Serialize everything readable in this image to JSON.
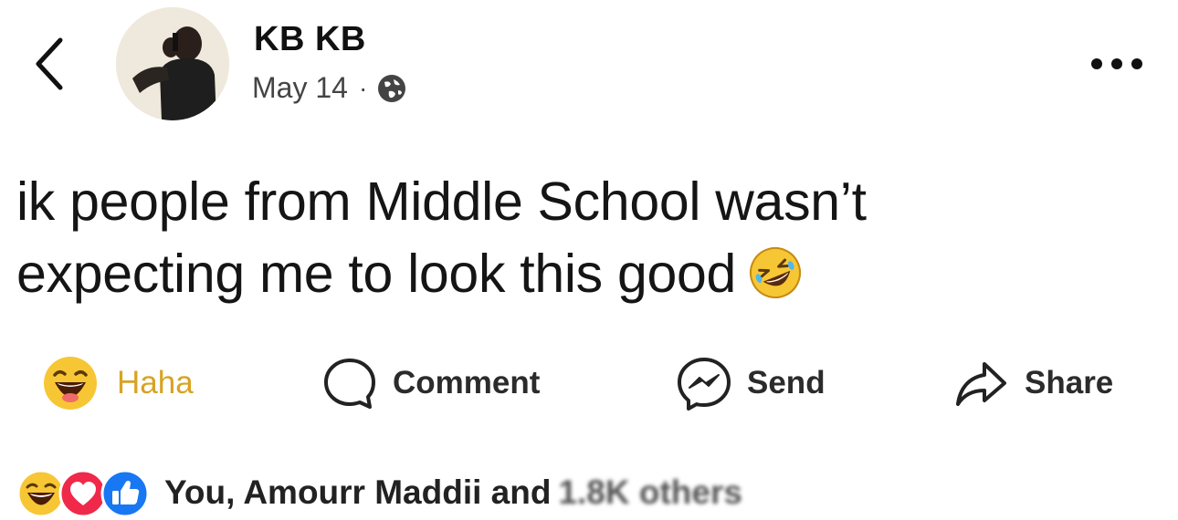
{
  "post": {
    "author": "KB KB",
    "date": "May 14",
    "separator": "·",
    "privacy_icon": "globe-icon",
    "text": "ik people from Middle School wasn’t expecting me to look this good",
    "text_emoji": "rolling-on-floor-laughing-emoji"
  },
  "actions": {
    "haha_label": "Haha",
    "comment_label": "Comment",
    "send_label": "Send",
    "share_label": "Share"
  },
  "reactions": {
    "summary": "You, Amourr Maddii and",
    "obscured": "1.8K others",
    "icons": [
      "haha-icon",
      "love-icon",
      "like-icon"
    ]
  },
  "colors": {
    "haha_label": "#d8a322",
    "like_blue": "#1877f2",
    "love_red": "#f0284a",
    "emoji_yellow": "#f7c634"
  }
}
